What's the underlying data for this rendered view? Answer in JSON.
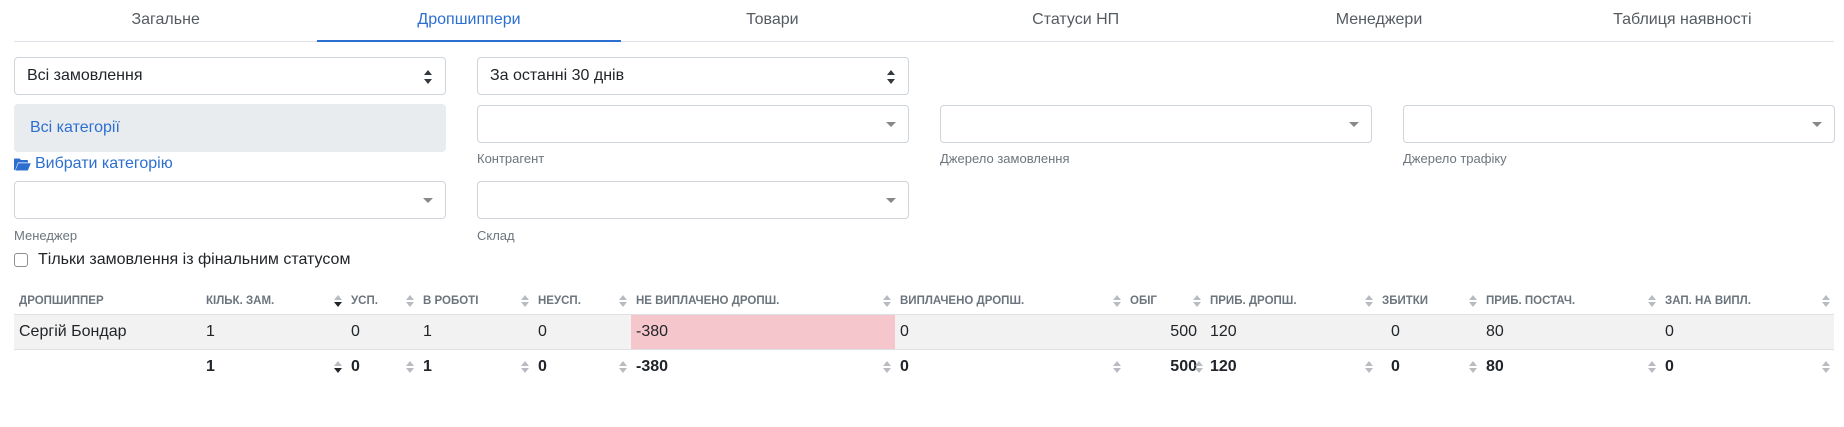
{
  "tabs": [
    {
      "label": "Загальне"
    },
    {
      "label": "Дропшиппери"
    },
    {
      "label": "Товари"
    },
    {
      "label": "Статуси НП"
    },
    {
      "label": "Менеджери"
    },
    {
      "label": "Таблиця наявності"
    }
  ],
  "active_tab": "Дропшиппери",
  "filters": {
    "orders_select": "Всі замовлення",
    "period_select": "За останні 30 днів",
    "categories": "Всі категорії",
    "choose_category": "Вибрати категорію",
    "counterparty_label": "Контрагент",
    "order_source_label": "Джерело замовлення",
    "traffic_source_label": "Джерело трафіку",
    "manager_label": "Менеджер",
    "warehouse_label": "Склад",
    "final_status_only": "Тільки замовлення із фінальним статусом"
  },
  "table": {
    "columns": [
      "Дропшиппер",
      "Кільк. зам.",
      "Усп.",
      "В роботі",
      "Неусп.",
      "Не виплачено дропш.",
      "Виплачено дропш.",
      "Обіг",
      "Приб. дропш.",
      "Збитки",
      "Приб. постач.",
      "Зап. на випл."
    ],
    "rows": [
      [
        "Сергій Бондар",
        "1",
        "0",
        "1",
        "0",
        "-380",
        "0",
        "500",
        "120",
        "0",
        "80",
        "0"
      ]
    ],
    "totals": [
      "",
      "1",
      "0",
      "1",
      "0",
      "-380",
      "0",
      "500",
      "120",
      "0",
      "80",
      "0"
    ]
  },
  "colors": {
    "accent": "#2c6fd1",
    "negative_cell": "#f5c6cb"
  }
}
